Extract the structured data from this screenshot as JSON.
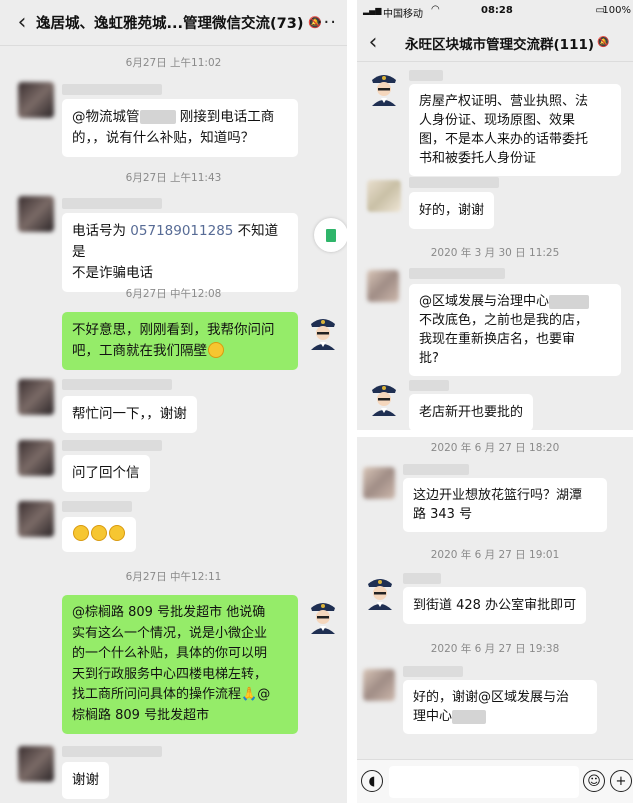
{
  "left": {
    "title": "逸居城、逸虹雅苑城...管理微信交流(73)",
    "ts": [
      "6月27日 上午11:02",
      "6月27日 上午11:43",
      "6月27日 中午12:08",
      "6月27日 中午12:11"
    ],
    "m1a": "@物流城管",
    "m1b": " 刚接到电话工商",
    "m1c": "的，，说有什么补贴，知道吗？",
    "m2a": "电话号为 ",
    "m2phone": "057189011285",
    "m2b": " 不知道是",
    "m2c": "不是诈骗电话",
    "m3a": "不好意思，刚刚看到，我帮你问问",
    "m3b": "吧，工商就在我们隔壁",
    "m4": "帮忙问一下，，谢谢",
    "m5": "问了回个信",
    "m7": [
      "@棕榈路 809 号批发超市  他说确",
      "实有这么一个情况，说是小微企业",
      "的一个什么补贴，具体的你可以明",
      "天到行政服务中心四楼电梯左转，",
      "找工商所问问具体的操作流程",
      "棕榈路 809 号批发超市"
    ],
    "m7at": "@",
    "m8": "谢谢"
  },
  "right": {
    "status": {
      "carrier": "中国移动",
      "time": "08:28",
      "battery": "100%"
    },
    "title": "永旺区块城市管理交流群(111)",
    "r1": [
      "房屋产权证明、营业执照、法",
      "人身份证、现场原图、效果",
      "图，不是本人来办的话带委托",
      "书和被委托人身份证"
    ],
    "r2": "好的，谢谢",
    "ts1": "2020 年 3 月 30 日  11:25",
    "r3a": "@区域发展与治理中心",
    "r3": [
      "不改底色，之前也是我的店，",
      "我现在重新换店名，也要审",
      "批?"
    ],
    "r4": "老店新开也要批的",
    "ts2": "2020 年 6 月 27 日  18:20",
    "r5": [
      "这边开业想放花篮行吗？湖潭",
      "路 343 号"
    ],
    "ts3": "2020 年 6 月 27 日  19:01",
    "r6": "到街道 428 办公室审批即可",
    "ts4": "2020 年 6 月 27 日  19:38",
    "r7": [
      "好的，谢谢@区域发展与治",
      "理中心"
    ]
  },
  "colors": {
    "bg": "#ededed",
    "green": "#95ec69",
    "link": "#576b95"
  },
  "icons": [
    "back-arrow-icon",
    "more-icon",
    "mute-bell-icon",
    "voice-icon",
    "emoji-icon",
    "plus-icon",
    "wifi-icon",
    "signal-icon",
    "battery-icon",
    "doc-icon"
  ]
}
